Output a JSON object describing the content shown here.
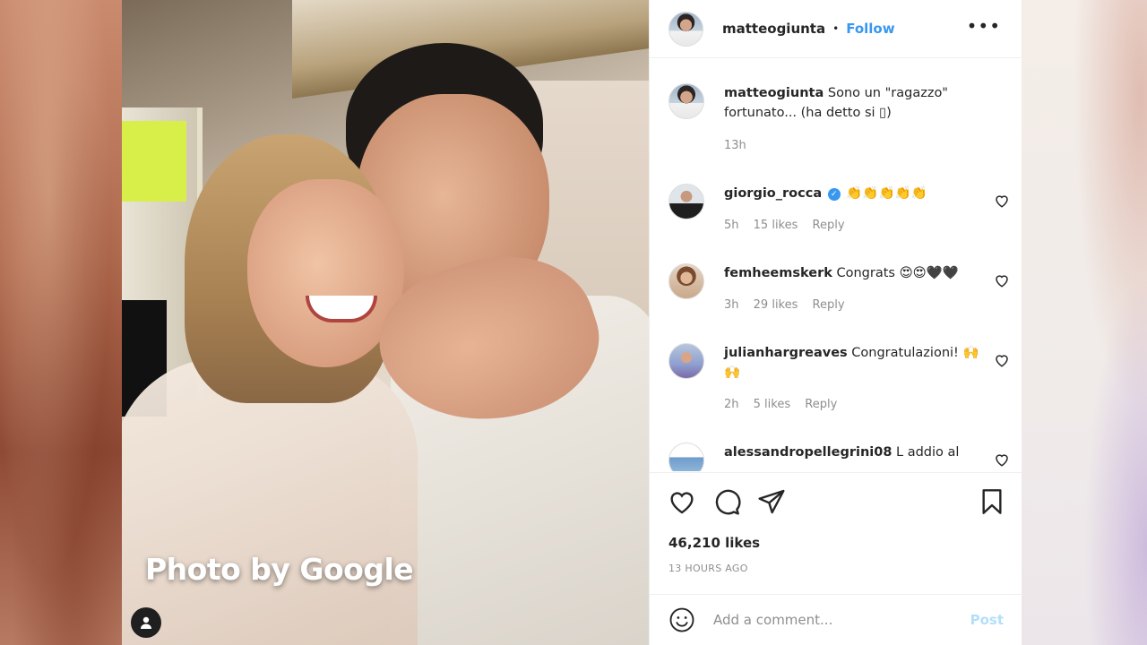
{
  "photo": {
    "caption": "Photo by Google"
  },
  "header": {
    "username": "matteogiunta",
    "separator": "•",
    "follow_label": "Follow",
    "more_label": "•••"
  },
  "caption": {
    "username": "matteogiunta",
    "text": "Sono un \"ragazzo\" fortunato... (ha detto si ▯)",
    "time": "13h"
  },
  "comments": [
    {
      "username": "giorgio_rocca",
      "verified": true,
      "text": "👏👏👏👏👏",
      "time": "5h",
      "likes": "15 likes",
      "reply": "Reply"
    },
    {
      "username": "femheemskerk",
      "verified": false,
      "text": "Congrats 😍😍🖤🖤",
      "time": "3h",
      "likes": "29 likes",
      "reply": "Reply"
    },
    {
      "username": "julianhargreaves",
      "verified": false,
      "text": "Congratulazioni! 🙌🙌",
      "time": "2h",
      "likes": "5 likes",
      "reply": "Reply"
    },
    {
      "username": "alessandropellegrini08",
      "verified": false,
      "text": "L addio al",
      "time": "",
      "likes": "",
      "reply": ""
    }
  ],
  "actions": {
    "likes": "46,210 likes",
    "time_ago": "13 HOURS AGO"
  },
  "add_comment": {
    "placeholder": "Add a comment...",
    "post_label": "Post"
  },
  "colors": {
    "link_blue": "#3897f0",
    "post_disabled": "#b2dffc",
    "text_primary": "#262626",
    "text_secondary": "#8e8e8e"
  }
}
